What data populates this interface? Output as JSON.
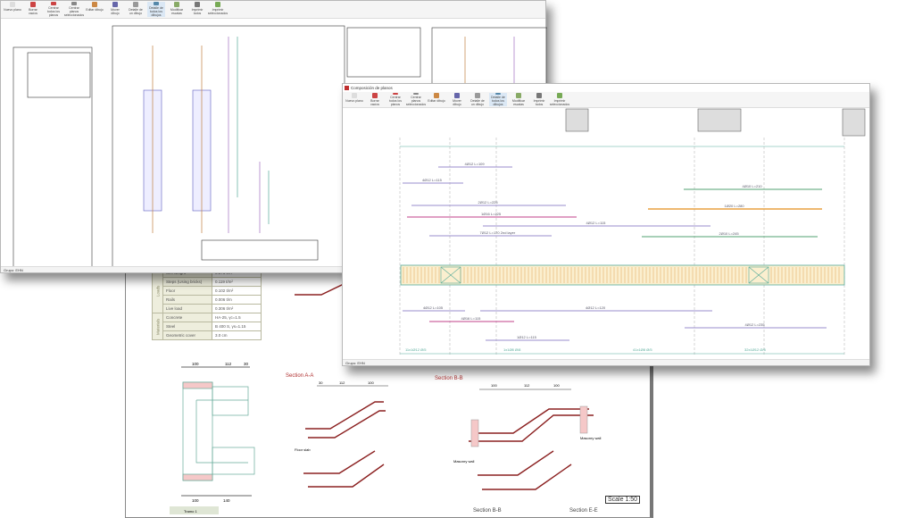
{
  "toolbar_buttons": [
    "Nuevo plano",
    "Borrar vacíos",
    "Centrar todos los planos",
    "Centrar planos seleccionados",
    "Editar dibujo",
    "Mover dibujo",
    "Detalle de un dibujo",
    "Detalle de todos los dibujos",
    "Modificar escalas",
    "Imprimir todos",
    "Imprimir seleccionados"
  ],
  "back_window": {
    "status": "Grupo: EHN"
  },
  "front_window": {
    "title": "Composición de planos",
    "status": "Grupo: EHN",
    "rebars": {
      "r1": "4Ø12 L=109",
      "r2": "4Ø12 L=115",
      "r3": "2Ø12 L=225",
      "r4": "1Ø16 L=225",
      "r5": "4Ø12 L=115",
      "r6": "7Ø12 L=170 2nd layer",
      "r7": "4Ø10 L=210",
      "r8": "1Ø20 L=280",
      "r9": "2Ø10 L=245",
      "b1": "4Ø12 L=105",
      "b2": "4Ø12 L=120",
      "b3": "4Ø16 L=115",
      "b4": "4Ø12 L=235",
      "b5": "1Ø12 L=115",
      "s1": "11x1Ø12 Ø/5",
      "s2": "1x1Ø8 Ø/8",
      "s3": "41x1Ø8 Ø/5",
      "s4": "32x1Ø12 Ø/5"
    }
  },
  "document": {
    "table": {
      "groups": [
        {
          "label": "Loads",
          "rows": [
            [
              "Self weight",
              "0.375 t/m²"
            ],
            [
              "Steps (Using bricks)",
              "0.119 t/m²"
            ],
            [
              "Floor",
              "0.102 t/m²"
            ],
            [
              "Rails",
              "0.006 t/m"
            ],
            [
              "Live load",
              "0.306 t/m²"
            ]
          ]
        },
        {
          "label": "Materials",
          "rows": [
            [
              "Concrete",
              "HA-25, γc=1.5"
            ],
            [
              "Steel",
              "B 400 S, γs=1.15"
            ],
            [
              "Geometric cover",
              "3.0 cm"
            ]
          ]
        }
      ]
    },
    "plan_dims": {
      "top": [
        "100",
        "112",
        "30"
      ],
      "bottom": [
        "100",
        "140"
      ]
    },
    "section_a": {
      "title": "Section A-A",
      "dims": [
        "30",
        "112",
        "100"
      ]
    },
    "section_b": {
      "title": "Section B-B",
      "dims": [
        "100",
        "112",
        "100"
      ]
    },
    "labels": {
      "floor_slab": "Floor slab",
      "masonry_wall": "Masonry wall",
      "masonry_wall2": "Masonry wall"
    },
    "scale": "Scale 1:50",
    "footer": {
      "tramo": "Tramo 1",
      "sec1": "Section B-B",
      "sec2": "Section E-E"
    }
  },
  "colors": {
    "rebar_purple": "#9a8ccc",
    "rebar_magenta": "#c0408a",
    "rebar_orange": "#e8a040",
    "rebar_green": "#50a070",
    "section_red": "#8b2020",
    "axis": "#7aa"
  }
}
